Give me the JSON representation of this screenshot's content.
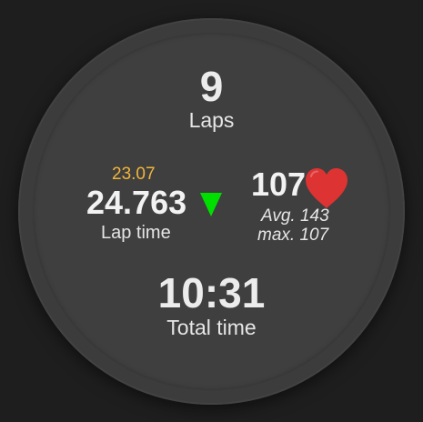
{
  "laps": {
    "value": "9",
    "label": "Laps"
  },
  "lap_time": {
    "best": "23.07",
    "current": "24.763",
    "label": "Lap time",
    "trend_icon": "down-triangle-icon",
    "trend_color": "#00e000",
    "best_color": "#f2b53a"
  },
  "heart_rate": {
    "current": "107",
    "avg": "Avg. 143",
    "max": "max. 107",
    "icon": "heart-icon",
    "icon_color": "#dd3333"
  },
  "total_time": {
    "value": "10:31",
    "label": "Total time"
  },
  "colors": {
    "background": "#1e1e1e",
    "face": "#3f3f3f"
  }
}
